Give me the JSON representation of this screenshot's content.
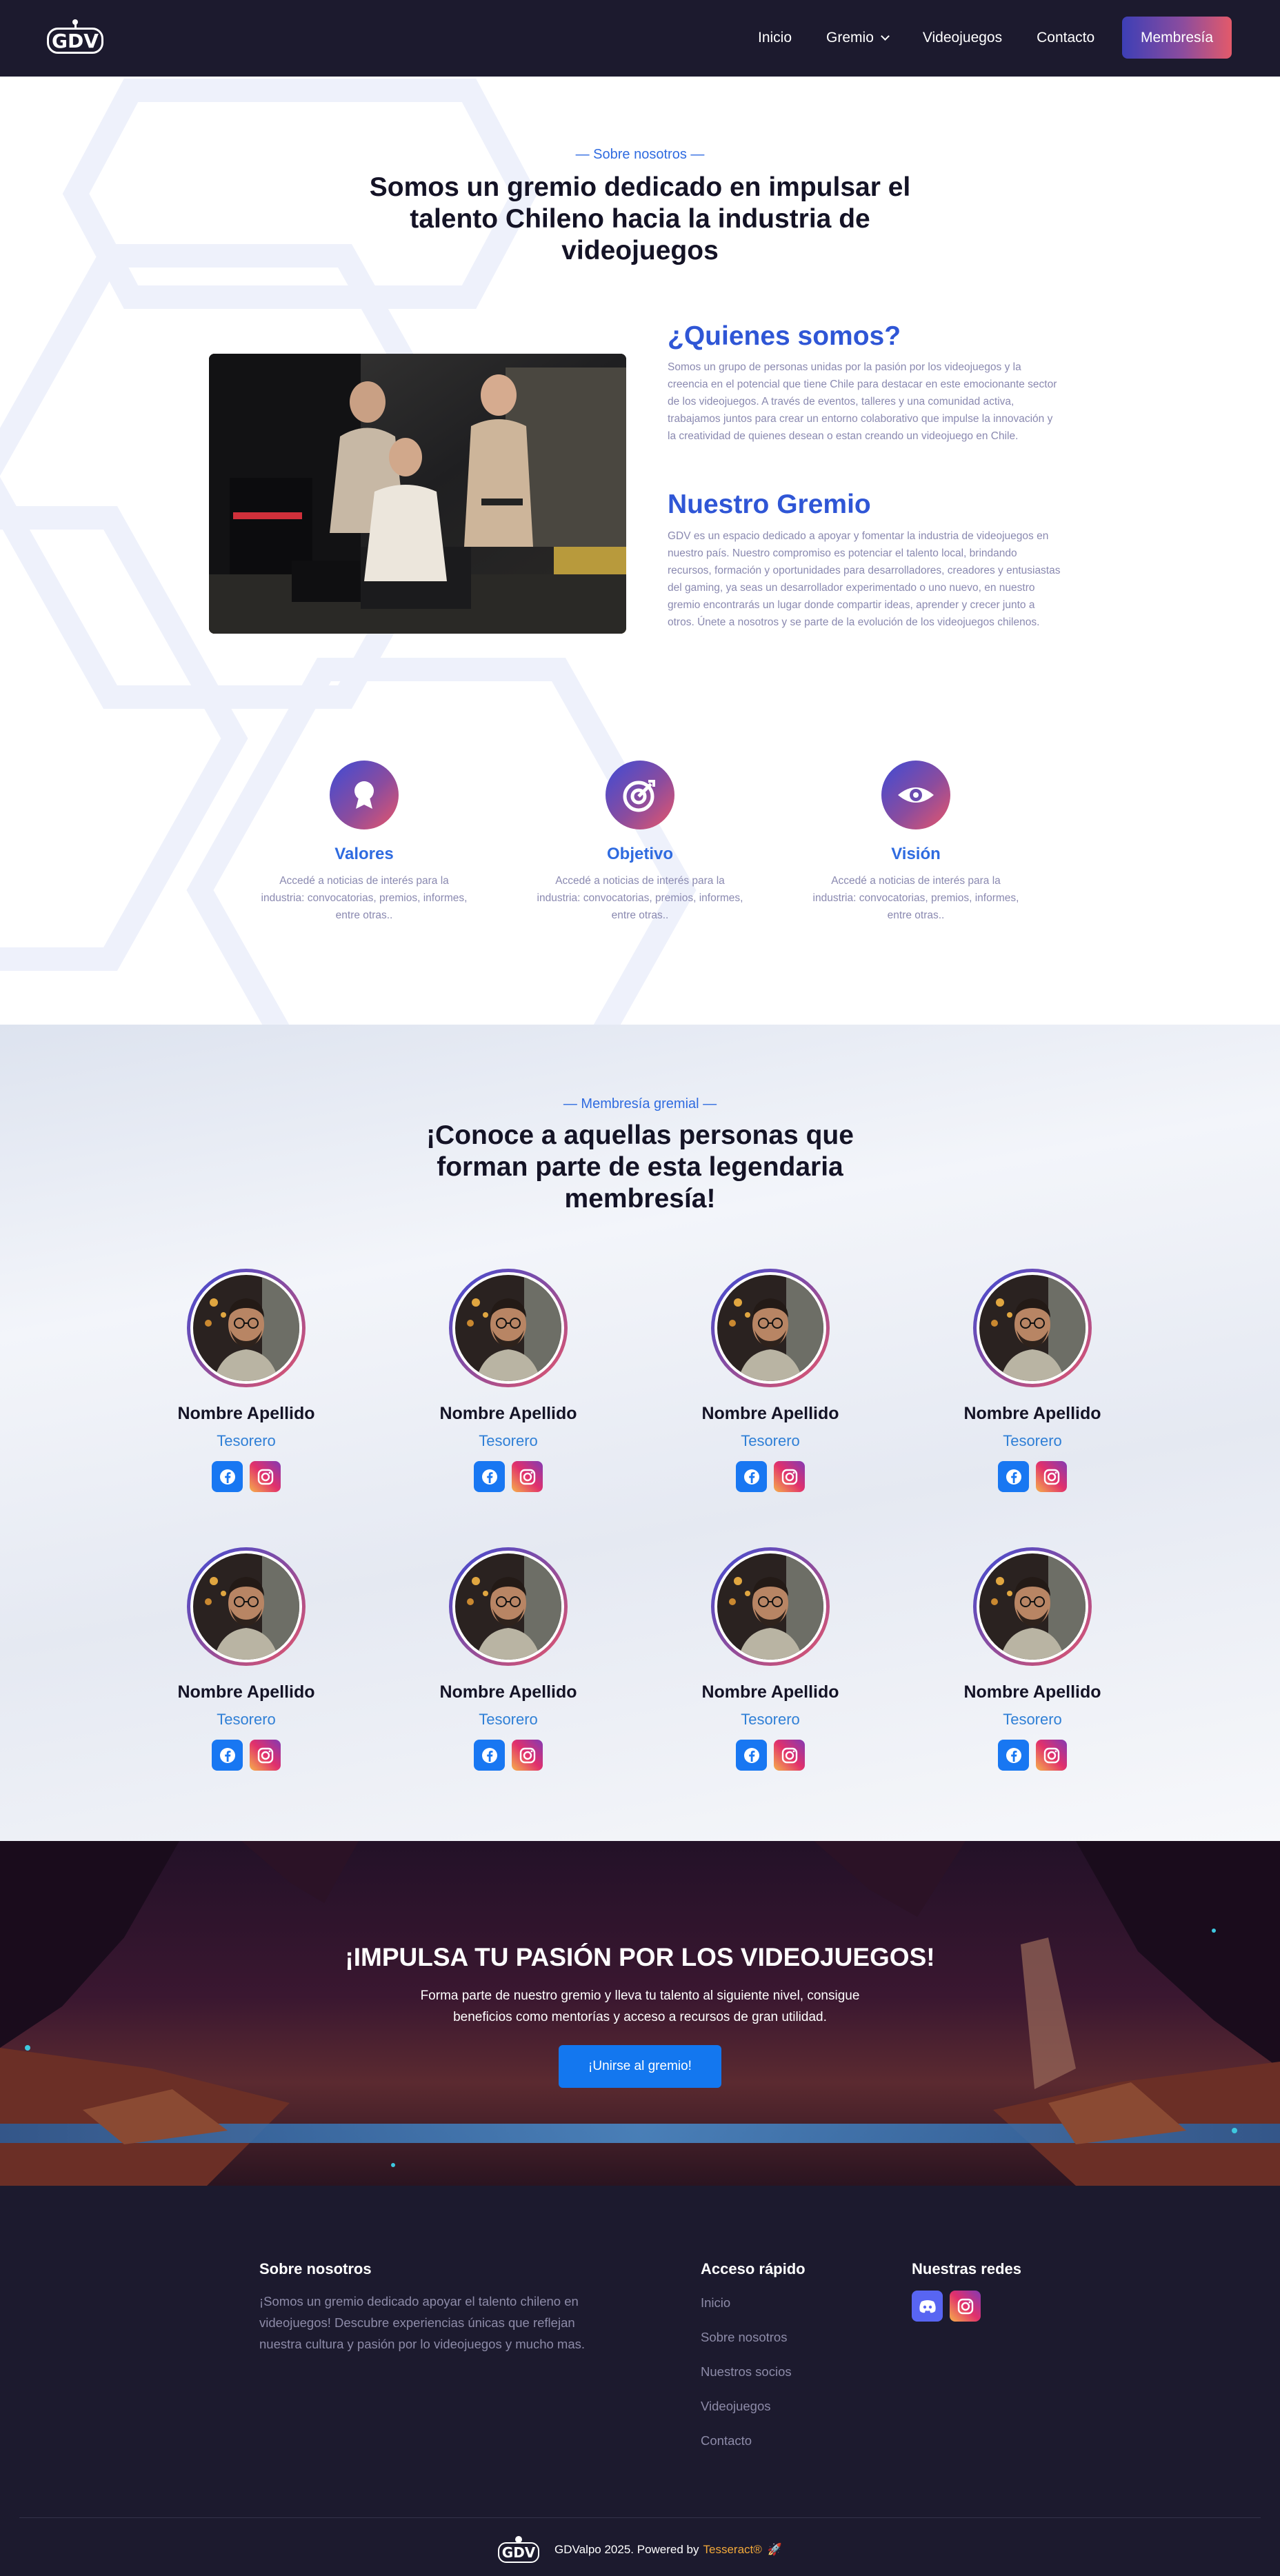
{
  "nav": {
    "logo_text": "GDV",
    "links": [
      {
        "label": "Inicio"
      },
      {
        "label": "Gremio"
      },
      {
        "label": "Videojuegos"
      },
      {
        "label": "Contacto"
      }
    ],
    "cta_label": "Membresía"
  },
  "about": {
    "eyebrow": "— Sobre nosotros —",
    "title": "Somos un gremio dedicado en impulsar el talento Chileno hacia la industria de videojuegos",
    "who_title": "¿Quienes somos?",
    "who_text": "Somos un grupo de personas unidas por la pasión por los videojuegos y la creencia en el potencial que tiene Chile para destacar en este emocionante sector de los videojuegos. A través de eventos, talleres y una comunidad activa, trabajamos juntos para crear un entorno colaborativo que impulse la innovación y la creatividad de quienes desean o estan creando un videojuego en Chile.",
    "guild_title": "Nuestro Gremio",
    "guild_text": "GDV es un espacio dedicado a apoyar y fomentar la industria de videojuegos en nuestro país. Nuestro compromiso es potenciar el talento local, brindando recursos, formación y oportunidades para desarrolladores, creadores y entusiastas del gaming, ya seas un desarrollador experimentado o uno nuevo, en nuestro gremio encontrarás un lugar donde compartir ideas, aprender y crecer junto a otros. Únete a nosotros y se parte de la evolución de los videojuegos chilenos.",
    "features": [
      {
        "title": "Valores",
        "text": "Accedé a noticias de interés para la industria: convocatorias, premios, informes, entre otras..",
        "icon": "award-icon"
      },
      {
        "title": "Objetivo",
        "text": "Accedé a noticias de interés para la industria: convocatorias, premios, informes, entre otras..",
        "icon": "target-icon"
      },
      {
        "title": "Visión",
        "text": "Accedé a noticias de interés para la industria: convocatorias, premios, informes, entre otras..",
        "icon": "eye-icon"
      }
    ]
  },
  "members": {
    "eyebrow": "— Membresía gremial —",
    "title": "¡Conoce a aquellas personas que forman parte de esta legendaria membresía!",
    "list": [
      {
        "name": "Nombre Apellido",
        "role": "Tesorero"
      },
      {
        "name": "Nombre Apellido",
        "role": "Tesorero"
      },
      {
        "name": "Nombre Apellido",
        "role": "Tesorero"
      },
      {
        "name": "Nombre Apellido",
        "role": "Tesorero"
      },
      {
        "name": "Nombre Apellido",
        "role": "Tesorero"
      },
      {
        "name": "Nombre Apellido",
        "role": "Tesorero"
      },
      {
        "name": "Nombre Apellido",
        "role": "Tesorero"
      },
      {
        "name": "Nombre Apellido",
        "role": "Tesorero"
      }
    ]
  },
  "cta": {
    "title": "¡IMPULSA TU PASIÓN POR LOS VIDEOJUEGOS!",
    "text": "Forma parte de nuestro gremio y lleva tu talento al siguiente nivel, consigue beneficios como mentorías y acceso a recursos de gran utilidad.",
    "button": "¡Unirse al gremio!"
  },
  "footer": {
    "about_title": "Sobre nosotros",
    "about_text": "¡Somos un gremio dedicado apoyar el talento chileno en videojuegos! Descubre experiencias únicas que reflejan nuestra cultura y pasión por lo videojuegos y mucho mas.",
    "links_title": "Acceso rápido",
    "links": [
      {
        "label": "Inicio"
      },
      {
        "label": "Sobre nosotros"
      },
      {
        "label": "Nuestros socios"
      },
      {
        "label": "Videojuegos"
      },
      {
        "label": "Contacto"
      }
    ],
    "social_title": "Nuestras redes",
    "logo_text": "GDV",
    "copyright": "GDValpo 2025. Powered by",
    "powered_by": "Tesseract®",
    "rocket": "🚀"
  },
  "colors": {
    "nav_bg": "#1c1a2e",
    "accent_blue": "#2f56d6",
    "gradient_start": "#3d4bd6",
    "gradient_end": "#e8566a",
    "cta_button": "#1377ef",
    "tesseract": "#f2a93b"
  }
}
